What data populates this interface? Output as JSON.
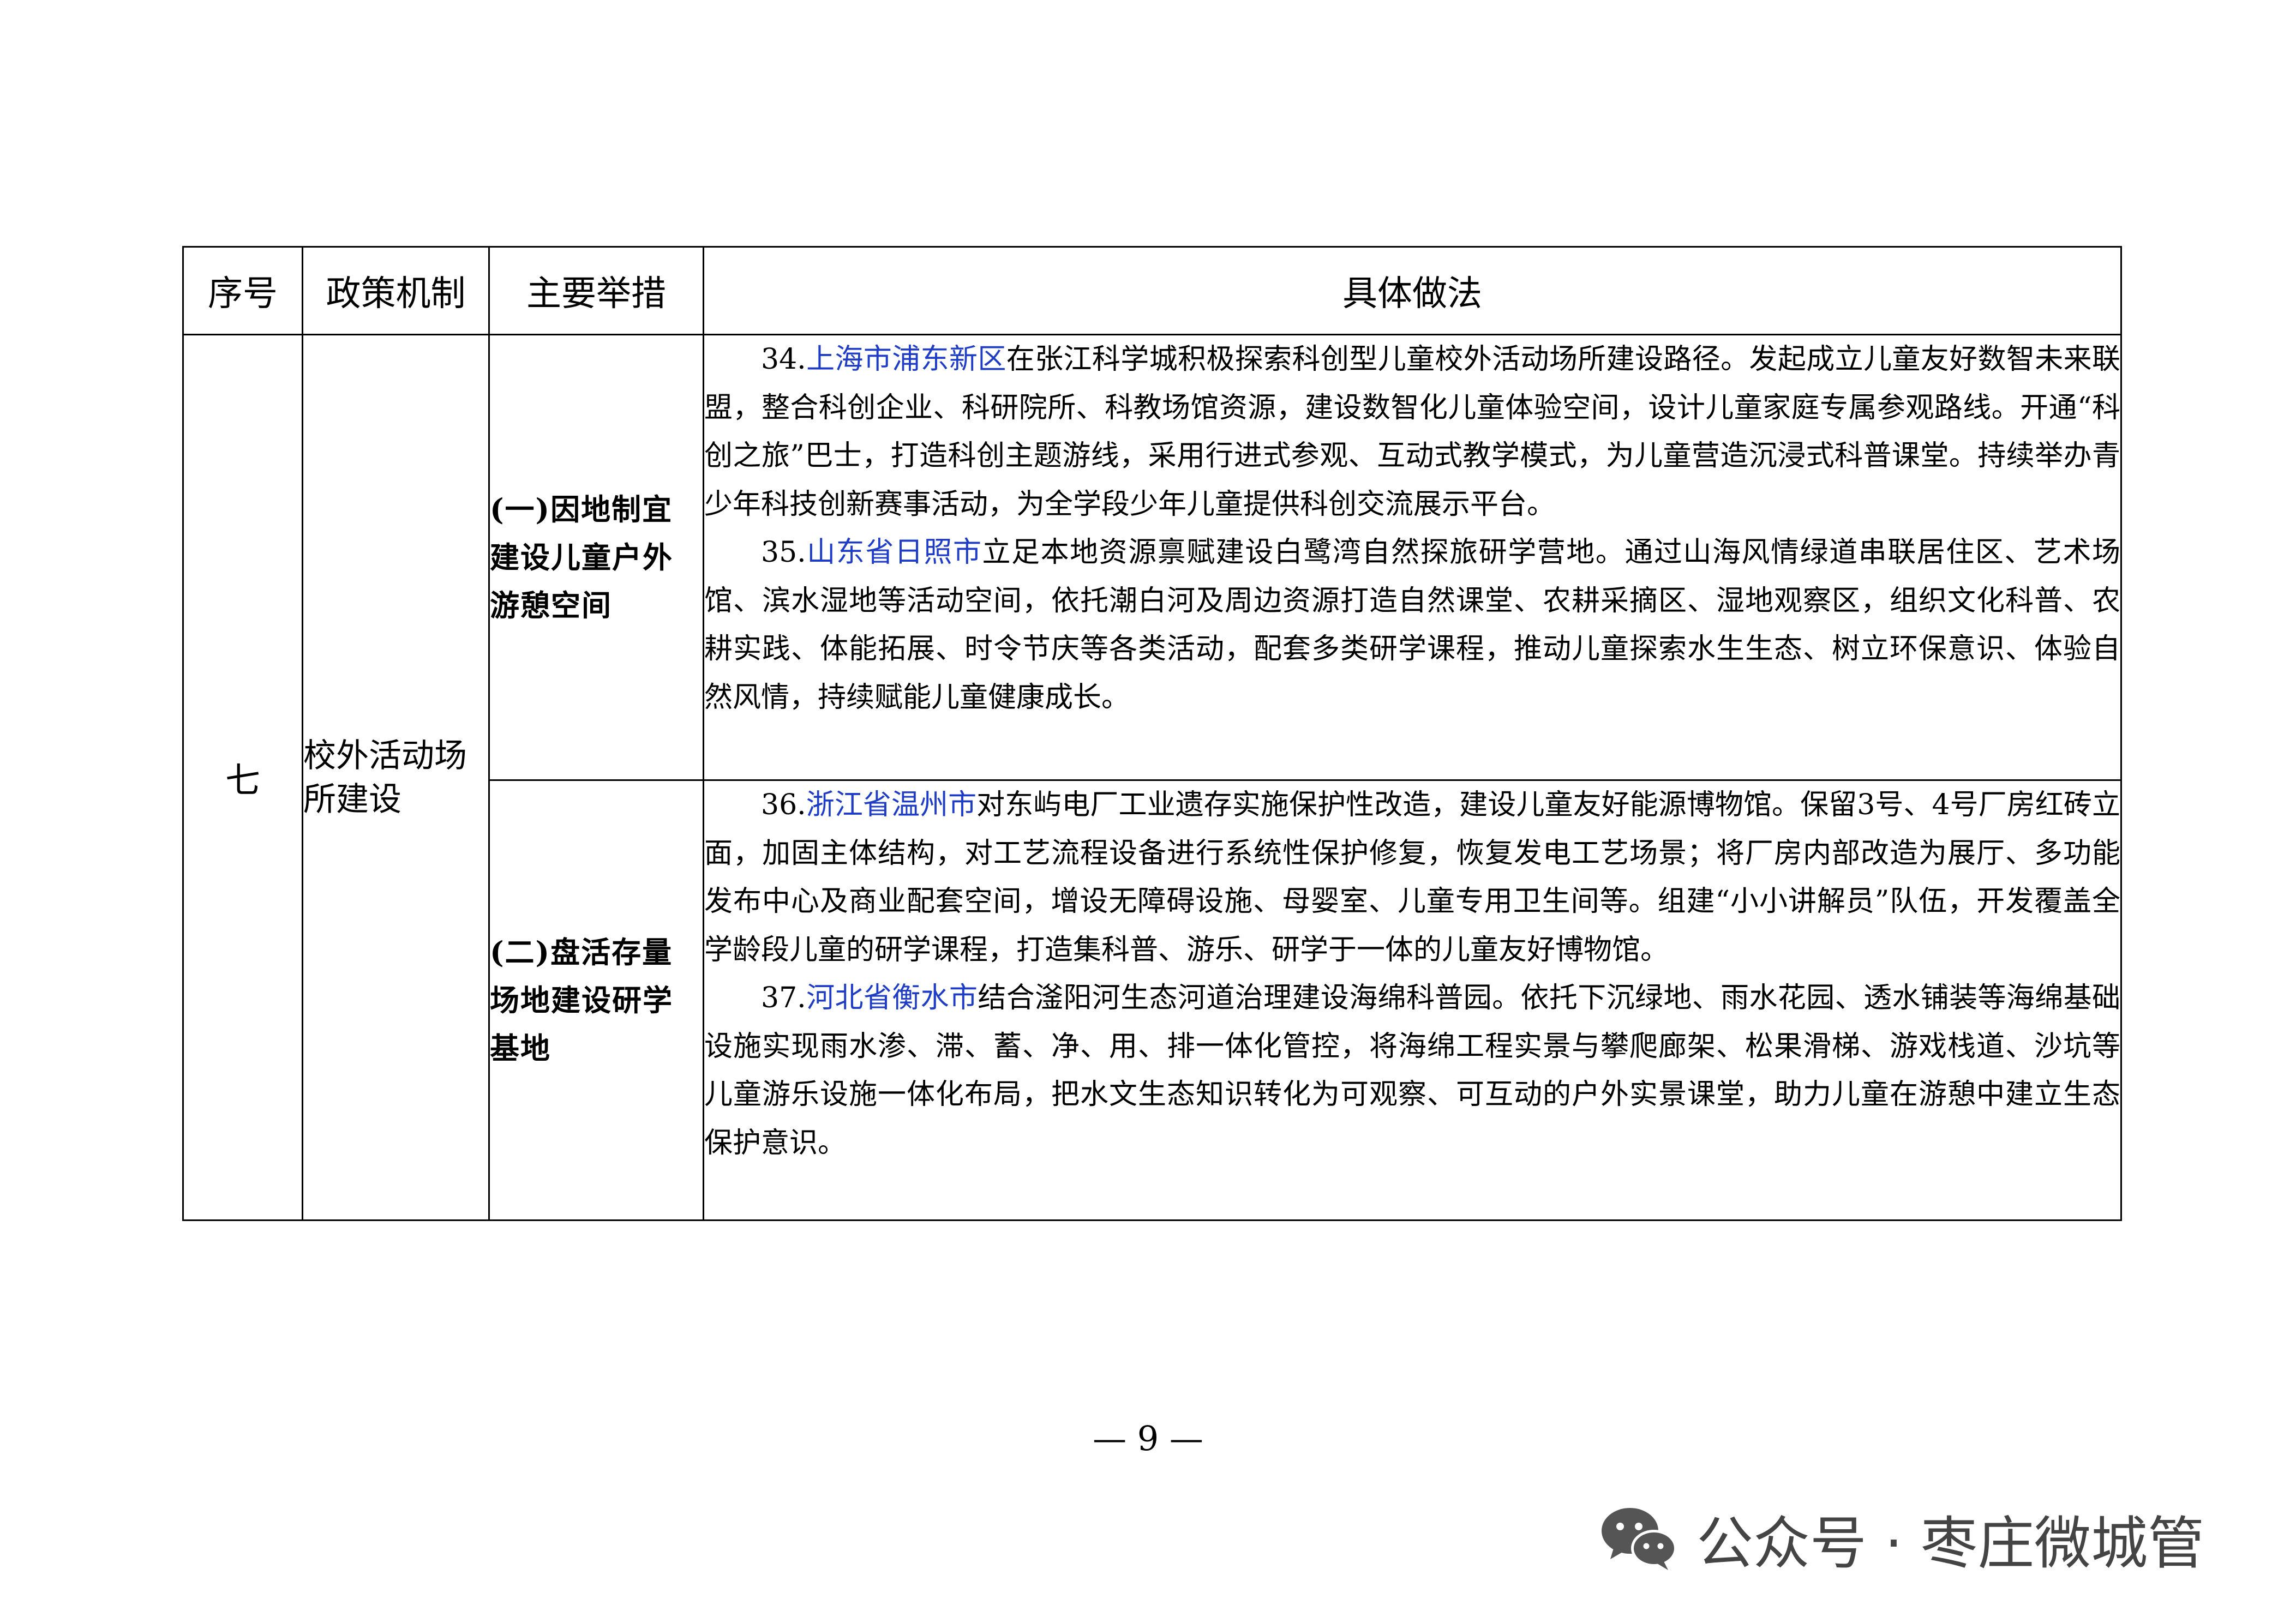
{
  "table": {
    "headers": {
      "seq": "序号",
      "mechanism": "政策机制",
      "measure": "主要举措",
      "detail": "具体做法"
    },
    "row": {
      "seq": "七",
      "mechanism": "校外活动场所建设",
      "groups": [
        {
          "measure": "(一)因地制宜建设儿童户外游憩空间",
          "items": [
            {
              "num": "34.",
              "place": "上海市浦东新区",
              "text": "在张江科学城积极探索科创型儿童校外活动场所建设路径。发起成立儿童友好数智未来联盟，整合科创企业、科研院所、科教场馆资源，建设数智化儿童体验空间，设计儿童家庭专属参观路线。开通“科创之旅”巴士，打造科创主题游线，采用行进式参观、互动式教学模式，为儿童营造沉浸式科普课堂。持续举办青少年科技创新赛事活动，为全学段少年儿童提供科创交流展示平台。"
            },
            {
              "num": "35.",
              "place": "山东省日照市",
              "text": "立足本地资源禀赋建设白鹭湾自然探旅研学营地。通过山海风情绿道串联居住区、艺术场馆、滨水湿地等活动空间，依托潮白河及周边资源打造自然课堂、农耕采摘区、湿地观察区，组织文化科普、农耕实践、体能拓展、时令节庆等各类活动，配套多类研学课程，推动儿童探索水生生态、树立环保意识、体验自然风情，持续赋能儿童健康成长。"
            }
          ]
        },
        {
          "measure": "(二)盘活存量场地建设研学基地",
          "items": [
            {
              "num": "36.",
              "place": "浙江省温州市",
              "text": "对东屿电厂工业遗存实施保护性改造，建设儿童友好能源博物馆。保留3号、4号厂房红砖立面，加固主体结构，对工艺流程设备进行系统性保护修复，恢复发电工艺场景；将厂房内部改造为展厅、多功能发布中心及商业配套空间，增设无障碍设施、母婴室、儿童专用卫生间等。组建“小小讲解员”队伍，开发覆盖全学龄段儿童的研学课程，打造集科普、游乐、研学于一体的儿童友好博物馆。"
            },
            {
              "num": "37.",
              "place": "河北省衡水市",
              "text": "结合滏阳河生态河道治理建设海绵科普园。依托下沉绿地、雨水花园、透水铺装等海绵基础设施实现雨水渗、滞、蓄、净、用、排一体化管控，将海绵工程实景与攀爬廊架、松果滑梯、游戏栈道、沙坑等儿童游乐设施一体化布局，把水文生态知识转化为可观察、可互动的户外实景课堂，助力儿童在游憩中建立生态保护意识。"
            }
          ]
        }
      ]
    }
  },
  "footer": {
    "page_number": "— 9 —"
  },
  "watermark": {
    "icon": "wechat-icon",
    "text": "公众号 · 枣庄微城管",
    "color": "#444444"
  },
  "colors": {
    "place_link": "#1f3cc4",
    "text": "#000000"
  }
}
